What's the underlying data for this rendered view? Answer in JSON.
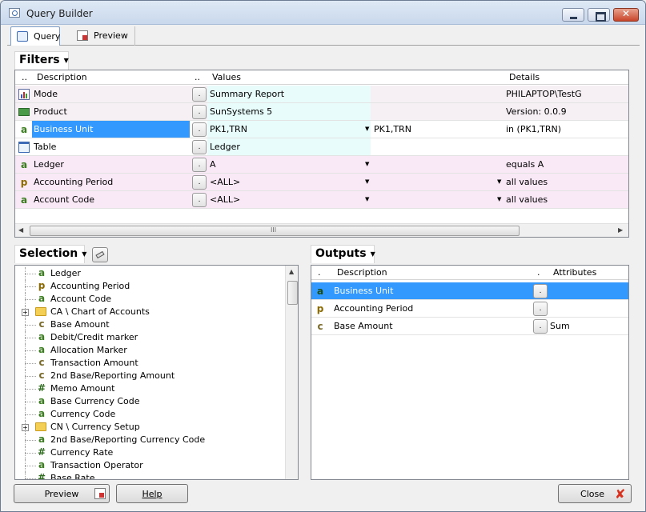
{
  "window": {
    "title": "Query Builder"
  },
  "tabs": [
    {
      "label": "Query"
    },
    {
      "label": "Preview"
    }
  ],
  "filters": {
    "label": "Filters",
    "headers": {
      "col0": "..",
      "description": "Description",
      "col2": "..",
      "values": "Values",
      "details": "Details"
    },
    "rows": [
      {
        "icon": "chart-icon",
        "description": "Mode",
        "value": "Summary Report",
        "value2": "",
        "details": "PHILAPTOP\\TestG"
      },
      {
        "icon": "product-icon",
        "description": "Product",
        "value": "SunSystems 5",
        "value2": "",
        "details": "Version: 0.0.9"
      },
      {
        "icon": "a",
        "description": "Business Unit",
        "value": "PK1,TRN",
        "value2": "PK1,TRN",
        "details": "in (PK1,TRN)"
      },
      {
        "icon": "table-icon",
        "description": "Table",
        "value": "Ledger",
        "value2": "",
        "details": ""
      },
      {
        "icon": "a",
        "description": "Ledger",
        "value": "A",
        "value2": "",
        "details": "equals A"
      },
      {
        "icon": "p",
        "description": "Accounting Period",
        "value": "<ALL>",
        "value2": "",
        "details": "all values"
      },
      {
        "icon": "a",
        "description": "Account Code",
        "value": "<ALL>",
        "value2": "",
        "details": "all values"
      }
    ],
    "dot_label": ".",
    "hscroll_label": "III"
  },
  "selection": {
    "label": "Selection",
    "items": [
      {
        "icon": "a",
        "label": "Ledger"
      },
      {
        "icon": "p",
        "label": "Accounting Period"
      },
      {
        "icon": "a",
        "label": "Account Code"
      },
      {
        "icon": "folder",
        "label": "CA \\ Chart of Accounts"
      },
      {
        "icon": "c",
        "label": "Base Amount"
      },
      {
        "icon": "a",
        "label": "Debit/Credit marker"
      },
      {
        "icon": "a",
        "label": "Allocation Marker"
      },
      {
        "icon": "c",
        "label": "Transaction Amount"
      },
      {
        "icon": "c",
        "label": "2nd Base/Reporting Amount"
      },
      {
        "icon": "#",
        "label": "Memo Amount"
      },
      {
        "icon": "a",
        "label": "Base Currency Code"
      },
      {
        "icon": "a",
        "label": "Currency Code"
      },
      {
        "icon": "folder",
        "label": "CN \\ Currency Setup"
      },
      {
        "icon": "a",
        "label": "2nd Base/Reporting Currency Code"
      },
      {
        "icon": "#",
        "label": "Currency Rate"
      },
      {
        "icon": "a",
        "label": "Transaction Operator"
      },
      {
        "icon": "#",
        "label": "Base Rate"
      }
    ]
  },
  "outputs": {
    "label": "Outputs",
    "headers": {
      "col0": ".",
      "description": "Description",
      "col2": ".",
      "attributes": "Attributes"
    },
    "rows": [
      {
        "icon": "a",
        "description": "Business Unit",
        "attributes": ""
      },
      {
        "icon": "p",
        "description": "Accounting Period",
        "attributes": ""
      },
      {
        "icon": "c",
        "description": "Base Amount",
        "attributes": "Sum"
      }
    ]
  },
  "buttons": {
    "preview": "Preview",
    "help": "Help",
    "close": "Close"
  },
  "colors": {
    "selected": "#3399ff",
    "values_bg": "#e8fcfc",
    "pink_bg": "#f9e8f6",
    "gray_bg": "#f6f0f5"
  }
}
